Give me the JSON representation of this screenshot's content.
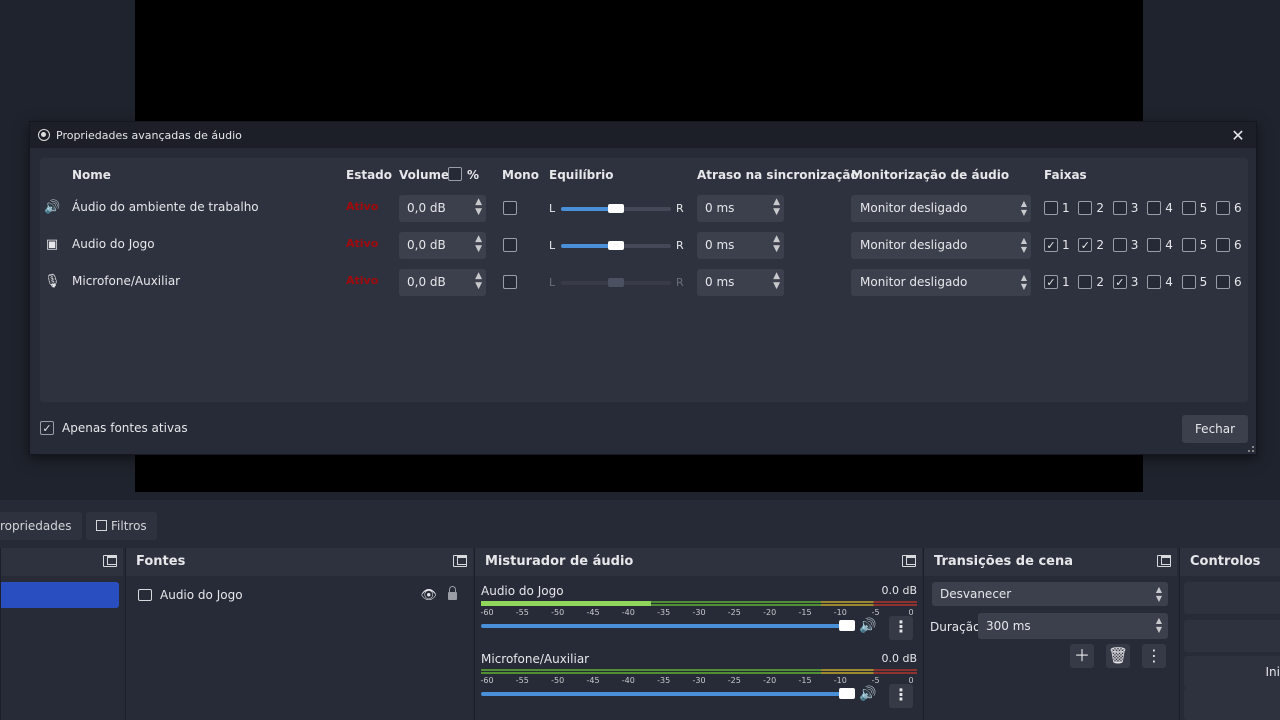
{
  "dialog": {
    "title": "Propriedades avançadas de áudio",
    "headers": {
      "name": "Nome",
      "state": "Estado",
      "volume": "Volume",
      "percent": "%",
      "mono": "Mono",
      "balance": "Equilíbrio",
      "sync": "Atraso na sincronização",
      "monitoring": "Monitorização de áudio",
      "tracks": "Faixas"
    },
    "rows": [
      {
        "icon": "speaker-icon",
        "name": "Áudio do ambiente de trabalho",
        "state": "Ativo",
        "volume": "0,0 dB",
        "mono": false,
        "bal_left": "L",
        "bal_right": "R",
        "balance": 0.5,
        "sync": "0 ms",
        "monitoring": "Monitor desligado",
        "tracks": [
          false,
          false,
          false,
          false,
          false,
          false
        ],
        "enabled": true
      },
      {
        "icon": "game-capture-icon",
        "name": "Audio do Jogo",
        "state": "Ativo",
        "volume": "0,0 dB",
        "mono": false,
        "bal_left": "L",
        "bal_right": "R",
        "balance": 0.5,
        "sync": "0 ms",
        "monitoring": "Monitor desligado",
        "tracks": [
          true,
          true,
          false,
          false,
          false,
          false
        ],
        "enabled": true
      },
      {
        "icon": "microphone-icon",
        "name": "Microfone/Auxiliar",
        "state": "Ativo",
        "volume": "0,0 dB",
        "mono": false,
        "bal_left": "L",
        "bal_right": "R",
        "balance": 0.5,
        "sync": "0 ms",
        "monitoring": "Monitor desligado",
        "tracks": [
          true,
          false,
          true,
          false,
          false,
          false
        ],
        "enabled": false
      }
    ],
    "track_labels": [
      "1",
      "2",
      "3",
      "4",
      "5",
      "6"
    ],
    "only_active_label": "Apenas fontes ativas",
    "only_active_checked": true,
    "close_label": "Fechar"
  },
  "tabs": {
    "properties": "ropriedades",
    "filters": "Filtros"
  },
  "sources_dock": {
    "title": "Fontes",
    "items": [
      {
        "name": "Audio do Jogo"
      }
    ]
  },
  "mixer": {
    "title": "Misturador de áudio",
    "channels": [
      {
        "name": "Audio do Jogo",
        "db": "0.0 dB",
        "level": 0.39
      },
      {
        "name": "Microfone/Auxiliar",
        "db": "0.0 dB",
        "level": 0.0
      }
    ],
    "ticks": [
      "-60",
      "-55",
      "-50",
      "-45",
      "-40",
      "-35",
      "-30",
      "-25",
      "-20",
      "-15",
      "-10",
      "-5",
      "0"
    ]
  },
  "transitions": {
    "title": "Transições de cena",
    "selected": "Desvanecer",
    "duration_label": "Duração",
    "duration_value": "300 ms"
  },
  "controls": {
    "title": "Controlos",
    "partial_button": "Ini"
  },
  "colors": {
    "accent": "#4a90d9",
    "selection": "#284ec0",
    "state_active": "#c00000"
  }
}
